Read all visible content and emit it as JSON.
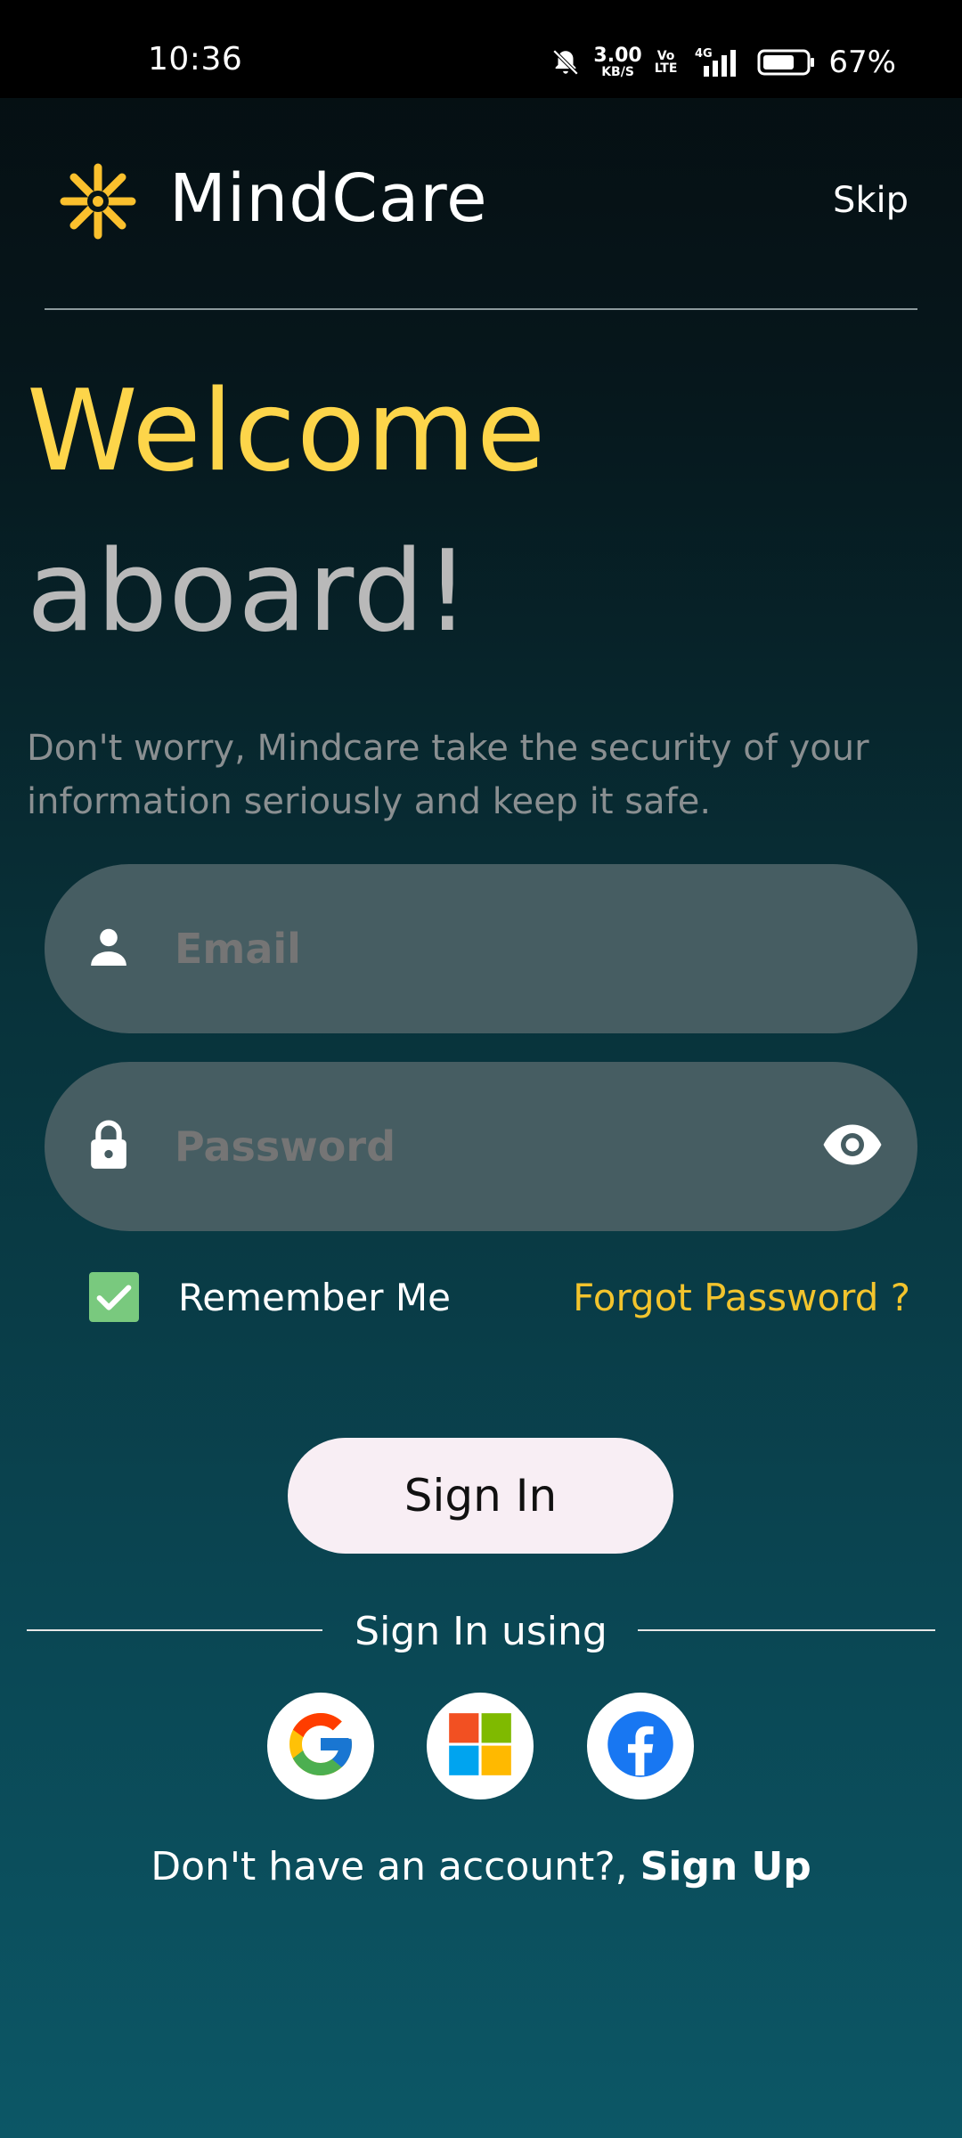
{
  "status_bar": {
    "time": "10:36",
    "net_speed_value": "3.00",
    "net_speed_unit": "KB/S",
    "volte_top": "Vo",
    "volte_bottom": "LTE",
    "network": "4G",
    "battery_percent": "67%"
  },
  "header": {
    "app_name": "MindCare",
    "skip_label": "Skip",
    "logo_color": "#fbc02d"
  },
  "hero": {
    "title_line1": "Welcome",
    "title_line2": "aboard!",
    "subtitle": "Don't worry, Mindcare take the security of your information seriously and keep it safe."
  },
  "form": {
    "email_placeholder": "Email",
    "password_placeholder": "Password",
    "remember_label": "Remember Me",
    "remember_checked": true,
    "forgot_label": "Forgot Password ?",
    "signin_label": "Sign In"
  },
  "social": {
    "divider_label": "Sign In using",
    "providers": [
      "google-icon",
      "microsoft-icon",
      "facebook-icon"
    ]
  },
  "footer": {
    "prompt": "Don't have an account?, ",
    "signup_label": "Sign Up"
  },
  "colors": {
    "accent_yellow": "#fdd54a",
    "field_bg": "#465d62",
    "button_bg": "#f8eef4",
    "checkbox_green": "#79c97e"
  }
}
